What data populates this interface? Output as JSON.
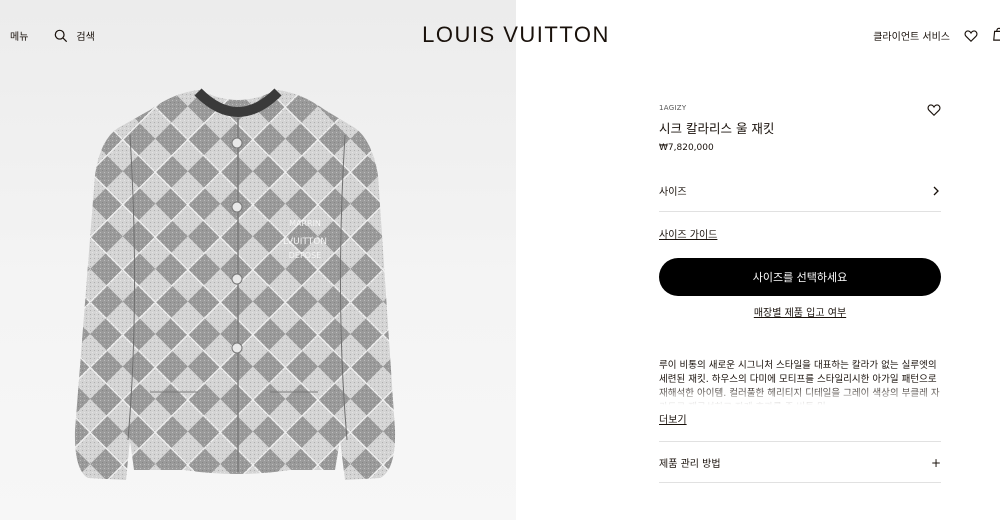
{
  "header": {
    "menu_label": "메뉴",
    "search_label": "검색",
    "logo": "LOUIS VUITTON",
    "client_service": "클라이언트 서비스"
  },
  "product": {
    "sku": "1AGIZY",
    "title": "시크 칼라리스 울 재킷",
    "price": "₩7,820,000",
    "size_label": "사이즈",
    "size_guide": "사이즈 가이드",
    "cta": "사이즈를 선택하세요",
    "stock_link": "매장별 제품 입고 여부",
    "description": "루이 비통의 새로운 시그니처 스타일을 대표하는 칼라가 없는 실루엣의 세련된 재킷. 하우스의 다미에 모티프를 스타일리시한 아가일 패턴으로 재해석한 아이템. 컬러풀한 헤리티지 디테일을 그레이 색상의 부클레 자카드로 재구성하고 자게 효과를 준 버튼 밑",
    "more": "더보기",
    "care": "제품 관리 방법"
  },
  "colors": {
    "accent": "#000000",
    "text": "#19110b",
    "divider": "#e1e1e1"
  },
  "icons": [
    "search-icon",
    "heart-icon",
    "shopping-bag-icon",
    "chevron-right-icon",
    "plus-icon"
  ]
}
